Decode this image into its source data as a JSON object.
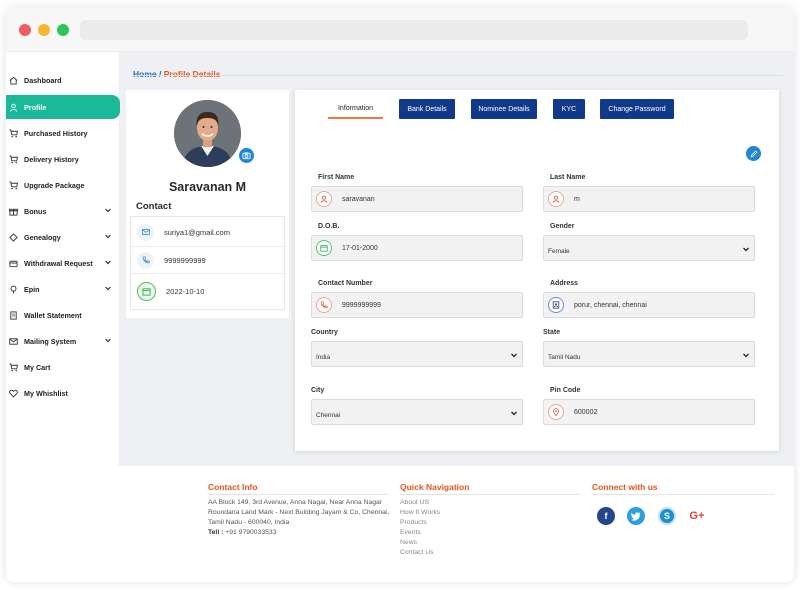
{
  "sidebar": {
    "items": [
      {
        "label": "Dashboard"
      },
      {
        "label": "Profile"
      },
      {
        "label": "Purchased History"
      },
      {
        "label": "Delivery History"
      },
      {
        "label": "Upgrade Package"
      },
      {
        "label": "Bonus"
      },
      {
        "label": "Genealogy"
      },
      {
        "label": "Withdrawal Request"
      },
      {
        "label": "Epin"
      },
      {
        "label": "Wallet Statement"
      },
      {
        "label": "Mailing System"
      },
      {
        "label": "My Cart"
      },
      {
        "label": "My Whishlist"
      }
    ]
  },
  "breadcrumb": {
    "home": "Home",
    "separator": "/",
    "current": "Profile Details"
  },
  "profile": {
    "name": "Saravanan M",
    "contact_title": "Contact",
    "email": "suriya1@gmail.com",
    "phone": "9999999999",
    "date": "2022-10-10"
  },
  "tabs": [
    {
      "label": "Information"
    },
    {
      "label": "Bank Details"
    },
    {
      "label": "Nominee Details"
    },
    {
      "label": "KYC"
    },
    {
      "label": "Change Password"
    }
  ],
  "form": {
    "first_name": {
      "label": "First Name",
      "value": "saravanan"
    },
    "last_name": {
      "label": "Last Name",
      "value": "m"
    },
    "dob": {
      "label": "D.O.B.",
      "value": "17-01-2000"
    },
    "gender": {
      "label": "Gender",
      "value": "Female"
    },
    "contact_number": {
      "label": "Contact Number",
      "value": "9999999999"
    },
    "address": {
      "label": "Address",
      "value": "porur, chennai, chennai"
    },
    "country": {
      "label": "Country",
      "value": "India"
    },
    "state": {
      "label": "State",
      "value": "Tamil Nadu"
    },
    "city": {
      "label": "City",
      "value": "Chennai"
    },
    "pin_code": {
      "label": "Pin Code",
      "value": "600002"
    }
  },
  "footer": {
    "contact_info_title": "Contact Info",
    "address_line1": "AA Block 149, 3rd Avenue, Anna Nagar, Near Anna Nagar",
    "address_line2": "Roundana Land Mark - Next Building Jayam & Co, Chennai,",
    "address_line3": "Tamil Nadu - 600040, India",
    "tel_label": "Tell :",
    "tel_value": "+91 9790033533",
    "quick_nav_title": "Quick Navigation",
    "quick_links": [
      "About US",
      "How It Works",
      "Products",
      "Events",
      "News",
      "Contact Us"
    ],
    "connect_title": "Connect with us",
    "social": [
      "facebook-icon",
      "twitter-icon",
      "skype-icon",
      "google-plus-icon"
    ]
  },
  "colors": {
    "accent_teal": "#1ab99a",
    "tab_navy": "#123a8a",
    "highlight_orange": "#e2571e",
    "link_blue": "#1f6fb5"
  }
}
